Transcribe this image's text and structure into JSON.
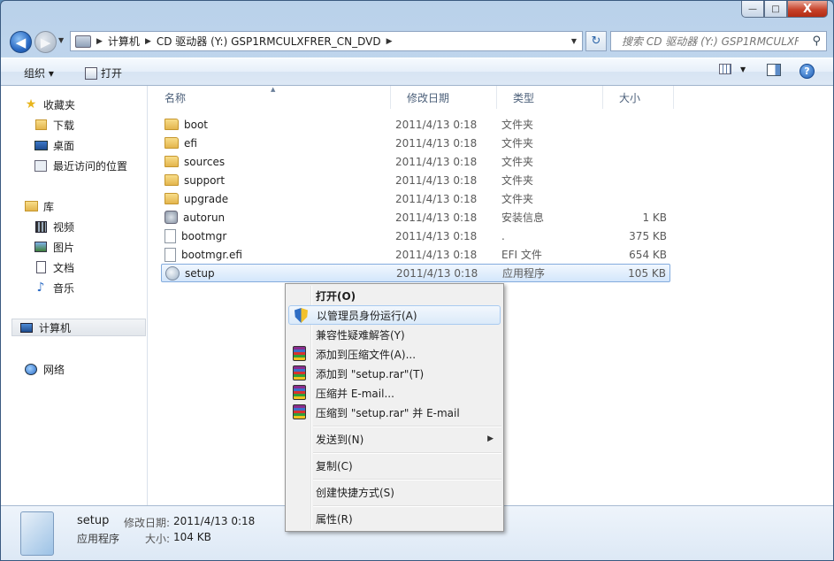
{
  "window": {
    "minimize_glyph": "—",
    "maximize_glyph": "□",
    "close_glyph": "X"
  },
  "nav": {
    "address_crumbs": [
      "计算机",
      "CD 驱动器 (Y:) GSP1RMCULXFRER_CN_DVD"
    ],
    "search_placeholder": "搜索 CD 驱动器 (Y:) GSP1RMCULXF..."
  },
  "toolbar": {
    "organize_label": "组织 ▾",
    "open_label": "打开"
  },
  "sidebar": {
    "favorites_label": "收藏夹",
    "favorites": [
      "下载",
      "桌面",
      "最近访问的位置"
    ],
    "libraries_label": "库",
    "libraries": [
      "视频",
      "图片",
      "文档",
      "音乐"
    ],
    "computer_label": "计算机",
    "network_label": "网络"
  },
  "columns": {
    "name": "名称",
    "date": "修改日期",
    "type": "类型",
    "size": "大小"
  },
  "files": [
    {
      "name": "boot",
      "date": "2011/4/13 0:18",
      "type": "文件夹",
      "size": "",
      "icon": "folder"
    },
    {
      "name": "efi",
      "date": "2011/4/13 0:18",
      "type": "文件夹",
      "size": "",
      "icon": "folder"
    },
    {
      "name": "sources",
      "date": "2011/4/13 0:18",
      "type": "文件夹",
      "size": "",
      "icon": "folder"
    },
    {
      "name": "support",
      "date": "2011/4/13 0:18",
      "type": "文件夹",
      "size": "",
      "icon": "folder"
    },
    {
      "name": "upgrade",
      "date": "2011/4/13 0:18",
      "type": "文件夹",
      "size": "",
      "icon": "folder"
    },
    {
      "name": "autorun",
      "date": "2011/4/13 0:18",
      "type": "安装信息",
      "size": "1 KB",
      "icon": "inf"
    },
    {
      "name": "bootmgr",
      "date": "2011/4/13 0:18",
      "type": ".",
      "size": "375 KB",
      "icon": "file"
    },
    {
      "name": "bootmgr.efi",
      "date": "2011/4/13 0:18",
      "type": "EFI 文件",
      "size": "654 KB",
      "icon": "file"
    },
    {
      "name": "setup",
      "date": "2011/4/13 0:18",
      "type": "应用程序",
      "size": "105 KB",
      "icon": "exe"
    }
  ],
  "context_menu": {
    "items": [
      "打开(O)",
      "以管理员身份运行(A)",
      "兼容性疑难解答(Y)",
      "添加到压缩文件(A)...",
      "添加到 \"setup.rar\"(T)",
      "压缩并 E-mail...",
      "压缩到 \"setup.rar\" 并 E-mail",
      "发送到(N)",
      "复制(C)",
      "创建快捷方式(S)",
      "属性(R)"
    ]
  },
  "details": {
    "name": "setup",
    "type": "应用程序",
    "modified_label": "修改日期:",
    "modified_value": "2011/4/13 0:18",
    "size_label": "大小:",
    "size_value": "104 KB"
  }
}
